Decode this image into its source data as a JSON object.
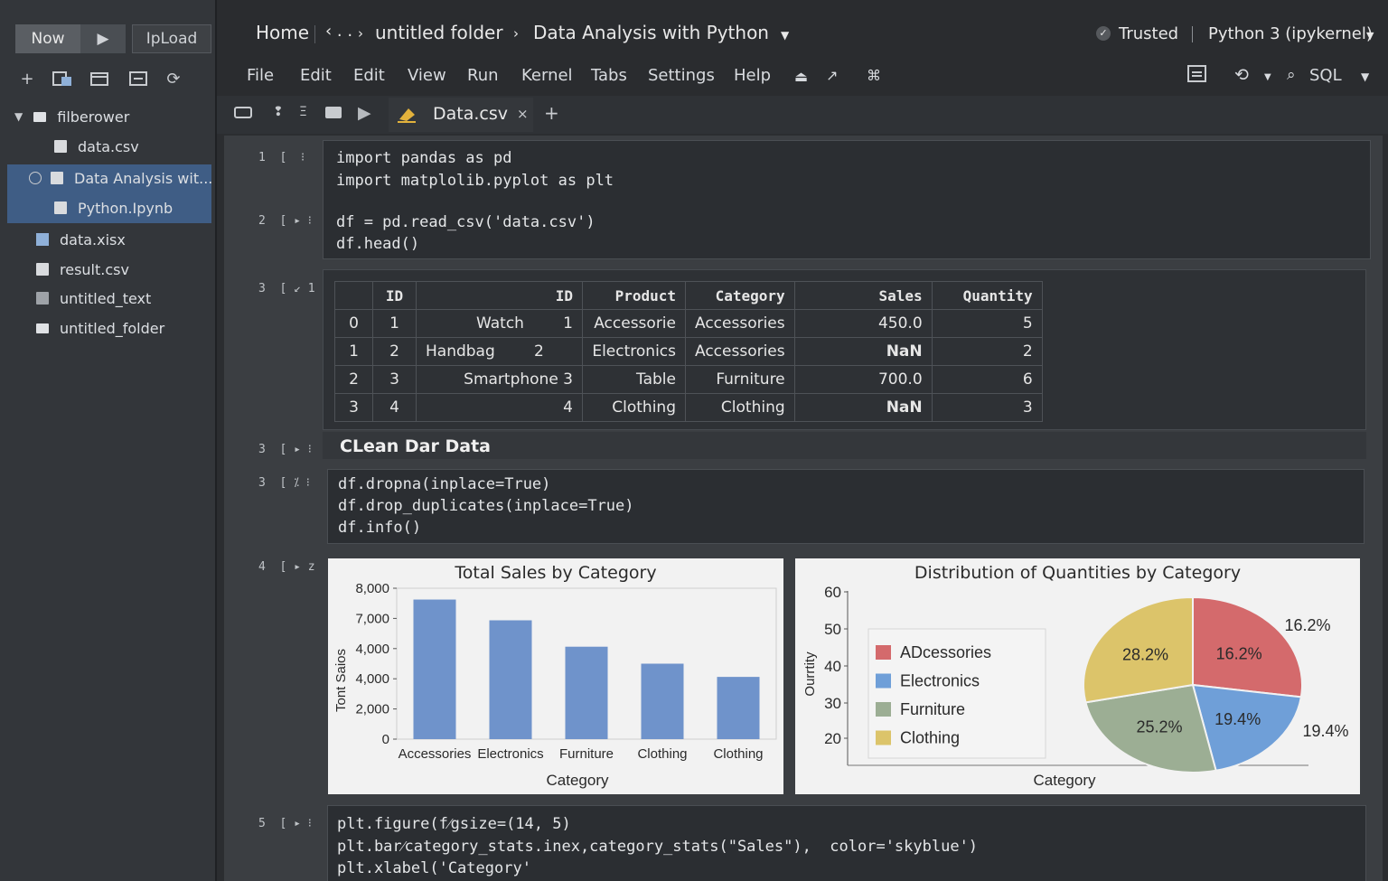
{
  "sidebar": {
    "new_label": "Now",
    "upload_label": "IpLoad",
    "tree": [
      {
        "label": "filberower",
        "kind": "folder"
      },
      {
        "label": "data.csv",
        "kind": "file"
      },
      {
        "label": "Data Analysis wit...",
        "kind": "notebook"
      },
      {
        "label": "Python.Ipynb",
        "kind": "notebook"
      },
      {
        "label": "data.xisx",
        "kind": "sheet"
      },
      {
        "label": "result.csv",
        "kind": "file"
      },
      {
        "label": "untitled_text",
        "kind": "file"
      },
      {
        "label": "untitled_folder",
        "kind": "folder"
      }
    ]
  },
  "header": {
    "home": "Home",
    "ellipsis": "‹ . .",
    "folder": "untitled folder",
    "notebook": "Data Analysis with Python",
    "trusted": "Trusted",
    "kernel": "Python 3 (ipykernel)"
  },
  "menu": [
    "File",
    "Edit",
    "Edit",
    "View",
    "Run",
    "Kernel",
    "Tabs",
    "Settings",
    "Help"
  ],
  "toolbar": {
    "sql_label": "SQL",
    "tab_label": "Data.csv",
    "tab_close": "×",
    "tab_add": "+"
  },
  "cells": {
    "c1_prompt": "1  [  ⁝",
    "c1_lines": [
      "import pandas as pd",
      "import matplolib.pyplot as plt"
    ],
    "c2_prompt": "2  [ ▸ ⁝",
    "c2_lines": [
      "df = pd.read_csv('data.csv')",
      "df.head()"
    ],
    "c3_prompt": "3  [ ↙ 1",
    "md_prompt": "3  [ ▸ ⁝",
    "md_text": "CLean Dar Data",
    "c4_prompt": "3  [ ⁒ ⁝",
    "c4_lines": [
      "df.dropna(inplace=True)",
      "df.drop_duplicates(inplace=True)",
      "df.info()"
    ],
    "c5_prompt": "4  [ ▸ z",
    "c6_prompt": "5  [ ▸ ⁝",
    "c6_lines": [
      "plt.figure(f⁄gsize=(14, 5)",
      "plt.bar⁄category_stats.inex,category_stats(\"Sales\"),  color='skyblue')",
      "plt.xlabel('Category'"
    ]
  },
  "table": {
    "headers": [
      "",
      "ID",
      "ID",
      "Product",
      "Category",
      "Sales",
      "Quantity"
    ],
    "rows": [
      [
        "0",
        "1",
        "Watch        1",
        "Accessorie",
        "Accessories",
        "450.0",
        "5"
      ],
      [
        "1",
        "2",
        "Handbag        2",
        "Electronics",
        "Accessories",
        "NaN",
        "2"
      ],
      [
        "2",
        "3",
        "Smartphone 3",
        "Table",
        "Furniture",
        "700.0",
        "6"
      ],
      [
        "3",
        "4",
        "4",
        "Clothing",
        "Clothing",
        "NaN",
        "3"
      ]
    ]
  },
  "chart_data": [
    {
      "type": "bar",
      "title": "Total Sales by Category",
      "xlabel": "Category",
      "ylabel": "Tont Saios",
      "categories": [
        "Accessories",
        "Electronics",
        "Furniture",
        "Clothing",
        "Clothing"
      ],
      "values": [
        7400,
        6300,
        4900,
        4000,
        3300
      ],
      "ytick_labels": [
        "8,000",
        "7,000",
        "4,000",
        "4,000",
        "2,000",
        "0"
      ],
      "ylim": [
        0,
        8000
      ],
      "bar_color": "#6f93cb"
    },
    {
      "type": "pie",
      "title": "Distribution of Quantities by Category",
      "xlabel": "Category",
      "ylabel": "Ourrtity",
      "yticks": [
        "60",
        "50",
        "40",
        "30",
        "20"
      ],
      "legend": [
        "ADcessories",
        "Electronics",
        "Furniture",
        "Clothing"
      ],
      "slices": [
        {
          "label": "Accessories",
          "value": 27.2,
          "pct_label": "16.2%",
          "color": "#d46a6c"
        },
        {
          "label": "Electronics",
          "value": 19.4,
          "pct_label": "19.4%",
          "color": "#6f9fd8"
        },
        {
          "label": "Furniture",
          "value": 25.2,
          "pct_label": "25.2%",
          "color": "#9cae94"
        },
        {
          "label": "Clothing",
          "value": 28.2,
          "pct_label": "28.2%",
          "color": "#dcc46a"
        }
      ],
      "outer_labels": [
        "16.2%",
        "19.4%"
      ]
    }
  ]
}
